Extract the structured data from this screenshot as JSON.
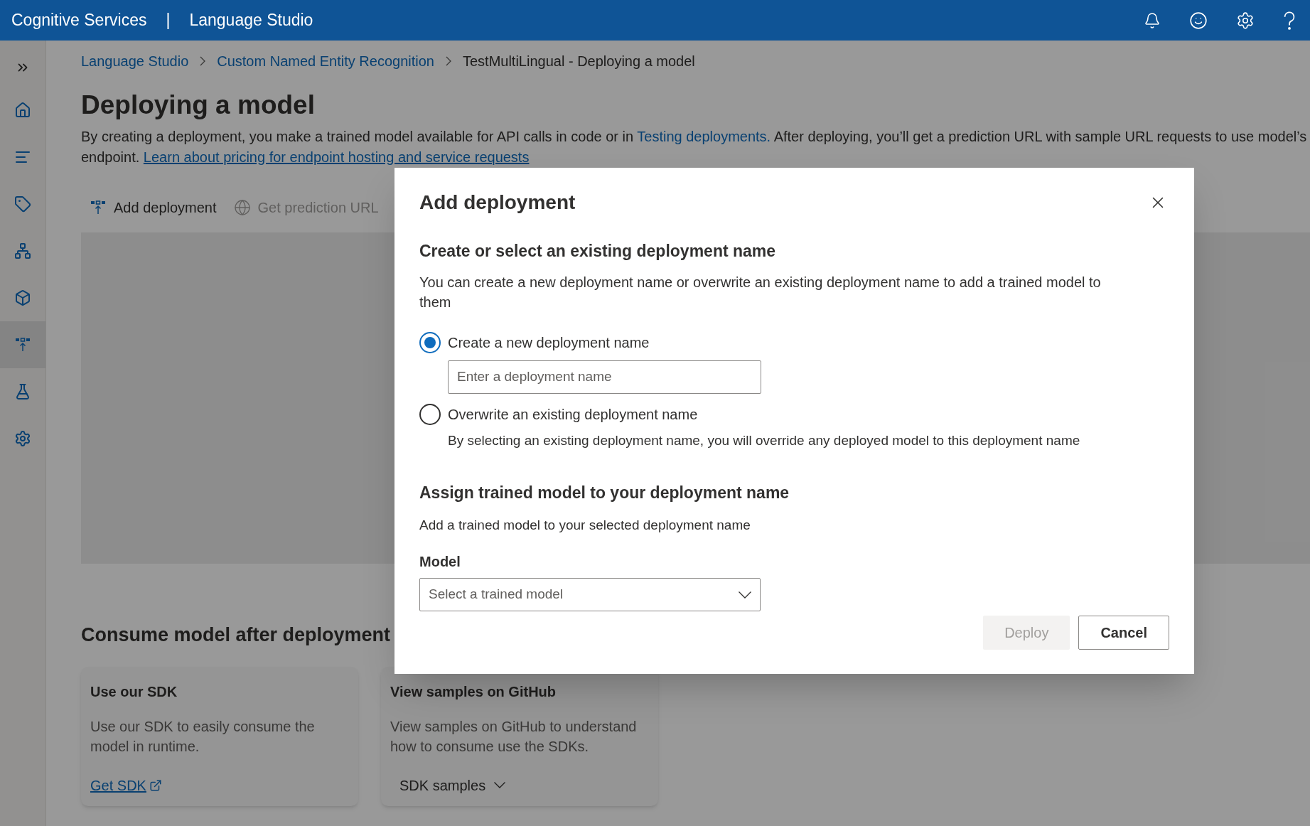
{
  "header": {
    "product": "Cognitive Services",
    "separator": "|",
    "app": "Language Studio"
  },
  "sidebar": {
    "items": [
      {
        "selected": false
      },
      {
        "selected": false
      },
      {
        "selected": false
      },
      {
        "selected": false
      },
      {
        "selected": false
      },
      {
        "selected": true
      },
      {
        "selected": false
      },
      {
        "selected": false
      }
    ]
  },
  "breadcrumb": [
    {
      "label": "Language Studio",
      "link": true
    },
    {
      "label": "Custom Named Entity Recognition",
      "link": true
    },
    {
      "label": "TestMultiLingual - Deploying a model",
      "link": false
    }
  ],
  "page": {
    "title": "Deploying a model",
    "description": [
      {
        "text": "By creating a deployment, you make a trained model available for API calls in code or in ",
        "kind": "text"
      },
      {
        "text": "Testing deployments.",
        "kind": "link"
      },
      {
        "text": " After deploying, you’ll get a prediction URL with sample URL requests to use model’s endpoint. ",
        "kind": "text"
      },
      {
        "text": "Learn about pricing for endpoint hosting and service requests",
        "kind": "underlined-link"
      }
    ]
  },
  "toolbar": [
    {
      "label": "Add deployment",
      "disabled": false
    },
    {
      "label": "Get prediction URL",
      "disabled": true
    }
  ],
  "consume": {
    "title": "Consume model after deployment",
    "cards": [
      {
        "title": "Use our SDK",
        "text": "Use our SDK to easily consume the model in runtime.",
        "action": {
          "label": "Get SDK",
          "kind": "link"
        }
      },
      {
        "title": "View samples on GitHub",
        "text": "View samples on GitHub to understand how to consume use the SDKs.",
        "action": {
          "label": "SDK samples",
          "kind": "dropdown"
        }
      }
    ]
  },
  "dialog": {
    "title": "Add deployment",
    "sections": [
      {
        "title": "Create or select an existing deployment name",
        "text": "You can create a new deployment name or overwrite an existing deployment name to add a trained model to them"
      }
    ],
    "options": [
      {
        "label": "Create a new deployment name",
        "selected": true,
        "placeholder": "Enter a deployment name"
      },
      {
        "label": "Overwrite an existing deployment name",
        "selected": false,
        "note": "By selecting an existing deployment name, you will override any deployed model to this deployment name"
      }
    ],
    "assign": {
      "title": "Assign trained model to your deployment name",
      "text": "Add a trained model to your selected deployment name",
      "field_label": "Model",
      "placeholder": "Select a trained model"
    },
    "buttons": [
      {
        "label": "Deploy",
        "disabled": true
      },
      {
        "label": "Cancel",
        "disabled": false
      }
    ]
  }
}
